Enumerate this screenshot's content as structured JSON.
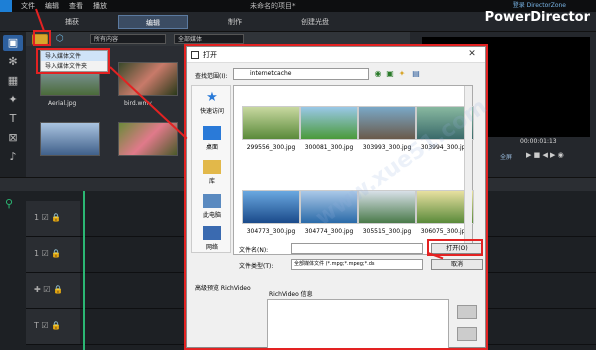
{
  "menubar": {
    "items": [
      "文件",
      "编辑",
      "查看",
      "播放"
    ],
    "title": "未命名的项目*",
    "logon": "登录 DirectorZone",
    "brand": "PowerDirector"
  },
  "tabs": {
    "capture": "捕获",
    "edit": "编辑",
    "produce": "制作",
    "create_disc": "创建光盘"
  },
  "library": {
    "filter": "所有内容",
    "media_type": "全部媒体",
    "context_menu": [
      "导入媒体文件",
      "导入媒体文件夹"
    ],
    "thumbs": [
      {
        "label": "Aerial.jpg"
      },
      {
        "label": "bird.wmv"
      }
    ]
  },
  "preview": {
    "timecode": "00:00:01:13",
    "full_label": "全屏"
  },
  "dialog": {
    "title": "打开",
    "lookin_label": "查找范围(I):",
    "lookin_value": "internetcache",
    "places": [
      "快速访问",
      "桌面",
      "库",
      "此电脑",
      "网络"
    ],
    "files": [
      "299556_300.jpg",
      "300081_300.jpg",
      "303993_300.jpg",
      "303994_300.jpg",
      "304773_300.jpg",
      "304774_300.jpg",
      "305515_300.jpg",
      "306075_300.jpg"
    ],
    "filename_label": "文件名(N):",
    "filename_value": "",
    "filetype_label": "文件类型(T):",
    "filetype_value": "全部媒体文件 (*.mpg;*.mpeg;*.ds",
    "open_button": "打开(O)",
    "cancel_button": "取消",
    "preview_label": "高级预览 RichVideo",
    "richvideo_label": "RichVideo 信息"
  },
  "colors": {
    "accent_red": "#e32222",
    "playhead": "#2bb673",
    "active_tab": "#3b4c63"
  }
}
